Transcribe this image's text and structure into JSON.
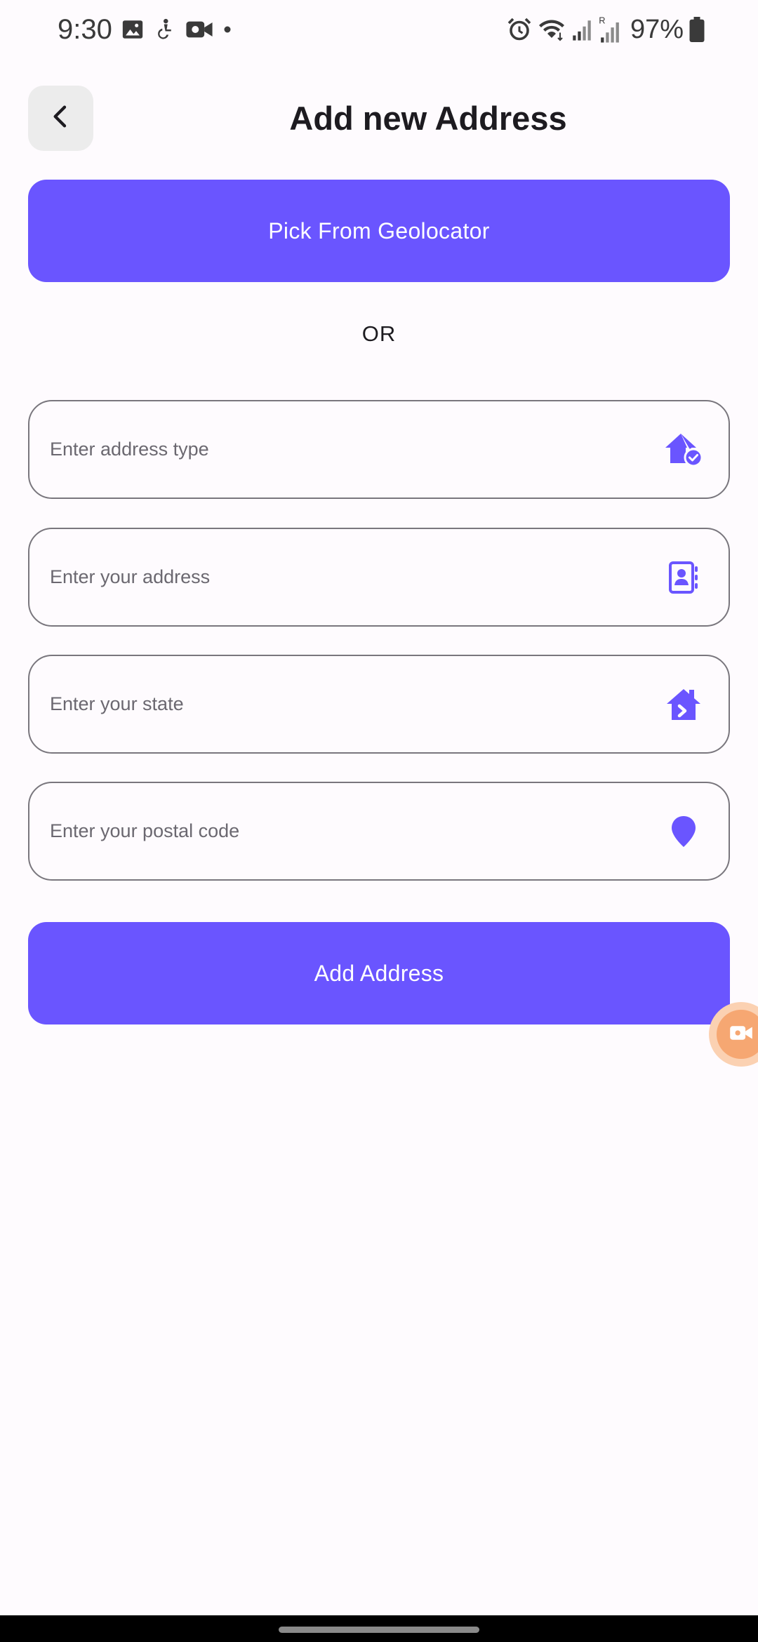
{
  "status_bar": {
    "time": "9:30",
    "battery": "97%",
    "left_icons": [
      "image-icon",
      "accessibility-icon",
      "video-camera-icon",
      "dot-icon"
    ],
    "right_icons": [
      "alarm-icon",
      "wifi-icon",
      "signal-icon",
      "signal-roaming-icon",
      "battery-icon"
    ]
  },
  "header": {
    "title": "Add new Address",
    "back_icon": "chevron-left-icon"
  },
  "geolocator_button": {
    "label": "Pick From Geolocator"
  },
  "divider": {
    "label": "OR"
  },
  "form": {
    "address_type": {
      "value": "",
      "placeholder": "Enter address type",
      "icon": "home-check-icon"
    },
    "address": {
      "value": "",
      "placeholder": "Enter your address",
      "icon": "contact-book-icon"
    },
    "state": {
      "value": "",
      "placeholder": "Enter your state",
      "icon": "home-arrow-icon"
    },
    "postal_code": {
      "value": "",
      "placeholder": "Enter your postal code",
      "icon": "location-pin-icon"
    }
  },
  "submit_button": {
    "label": "Add Address"
  },
  "colors": {
    "accent": "#6a55ff",
    "background": "#fefbfe",
    "field_border": "#79767d",
    "back_button_bg": "#ececec",
    "recorder_bubble": "#f6a772"
  }
}
